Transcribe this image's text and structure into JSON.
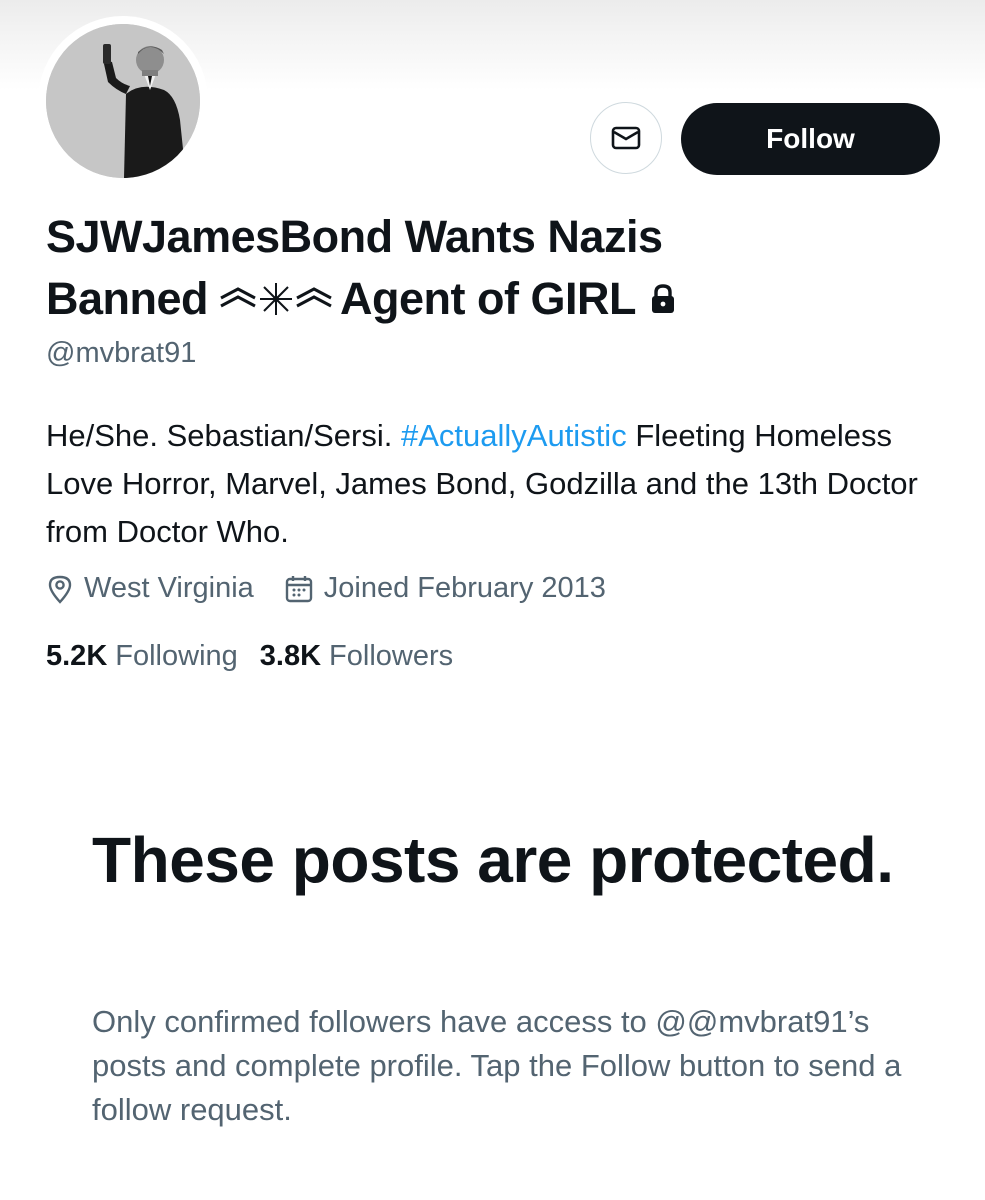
{
  "profile": {
    "display_name_line1": "SJWJamesBond Wants Nazis",
    "display_name_line2_a": "Banned",
    "display_name_line2_b": "Agent of GIRL",
    "handle": "@mvbrat91",
    "bio_prefix": "He/She. Sebastian/Sersi.",
    "bio_hashtag": "#ActuallyAutistic",
    "bio_suffix": "Fleeting Homeless Love Horror, Marvel, James Bond, Godzilla and the 13th Doctor from Doctor Who.",
    "location": "West Virginia",
    "joined": "Joined February 2013",
    "protected": true
  },
  "actions": {
    "follow_label": "Follow",
    "message_icon": "envelope-icon"
  },
  "stats": {
    "following_count": "5.2K",
    "following_label": "Following",
    "followers_count": "3.8K",
    "followers_label": "Followers"
  },
  "protected_notice": {
    "title": "These posts are protected.",
    "description": "Only confirmed followers have access to @@mvbrat91’s posts and complete profile. Tap the Follow button to send a follow request."
  },
  "colors": {
    "text_primary": "#0f1419",
    "text_secondary": "#536471",
    "link": "#1d9bf0",
    "button_dark": "#0f1419"
  }
}
